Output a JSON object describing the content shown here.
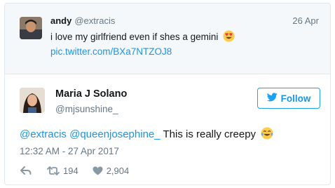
{
  "quoted_tweet": {
    "author_name": "andy",
    "author_handle": "@extracis",
    "date": "26 Apr",
    "text": "i love my girlfriend even if shes a gemini",
    "emoji": "heart-eyes-emoji",
    "link": "pic.twitter.com/BXa7NTZOJ8"
  },
  "tweet": {
    "author_name": "Maria J Solano",
    "author_handle": "@mjsunshine_",
    "follow_label": "Follow",
    "mention_1": "@extracis",
    "mention_2": "@queenjosephine_",
    "text": "This is really creepy",
    "emoji": "tears-of-joy-emoji",
    "timestamp": "12:32 AM - 27 Apr 2017",
    "retweets": "194",
    "likes": "2,904"
  },
  "icons": {
    "reply": "reply-icon",
    "retweet": "retweet-icon",
    "like": "heart-icon",
    "follow": "twitter-bird-icon"
  },
  "colors": {
    "accent": "#1da1f2",
    "link": "#1b95e0",
    "muted": "#657786",
    "quoted_background": "#f5f8fa"
  }
}
